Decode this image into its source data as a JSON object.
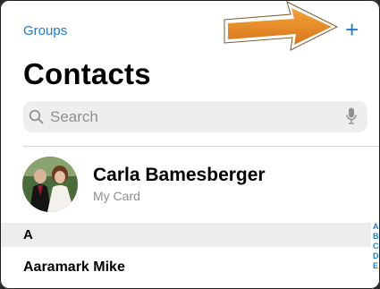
{
  "header": {
    "groups_label": "Groups",
    "add_glyph": "+",
    "title": "Contacts"
  },
  "search": {
    "placeholder": "Search"
  },
  "my_card": {
    "name": "Carla Bamesberger",
    "subtitle": "My Card"
  },
  "sections": [
    {
      "letter": "A",
      "contacts": [
        "Aaramark Mike"
      ]
    }
  ],
  "index_letters": [
    "A",
    "B",
    "C",
    "D",
    "E"
  ],
  "colors": {
    "accent": "#1e7bd6",
    "annotation_arrow": "#e38a1c"
  }
}
